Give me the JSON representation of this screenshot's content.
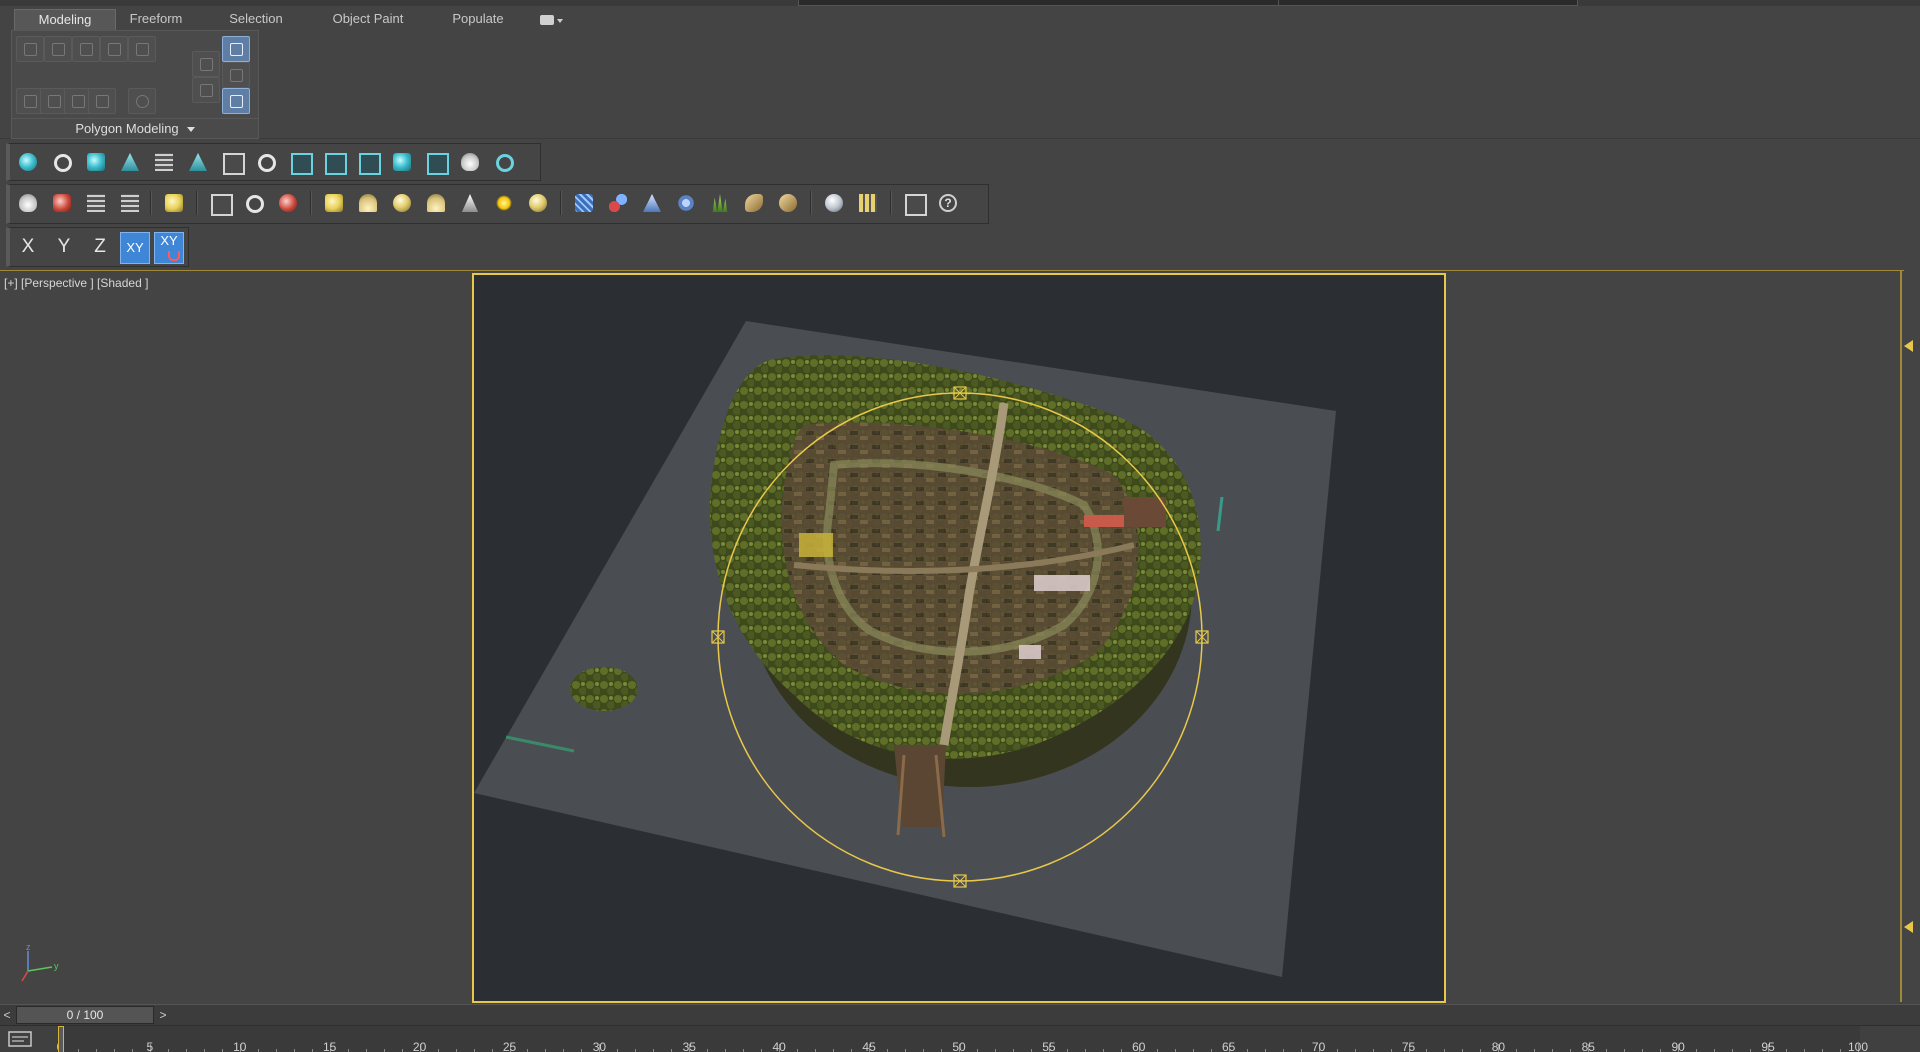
{
  "ribbon": {
    "tabs": [
      {
        "label": "Modeling",
        "active": true
      },
      {
        "label": "Freeform",
        "active": false
      },
      {
        "label": "Selection",
        "active": false
      },
      {
        "label": "Object Paint",
        "active": false
      },
      {
        "label": "Populate",
        "active": false
      }
    ],
    "panel_label": "Polygon Modeling"
  },
  "toolbars": {
    "row1_icons": [
      "light-bulb-icon",
      "sun-light-icon",
      "camera-group-icon",
      "tree-icon",
      "list-icon",
      "prism-icon",
      "tag-icon",
      "ring-icon",
      "render-frame-icon",
      "move-frame-icon",
      "play-frame-icon",
      "camera-icon",
      "frame-icon",
      "teapot-icon",
      "bulb-icon"
    ],
    "row2_icons": [
      "teapot-icon",
      "render-setup-icon",
      "panel-icon",
      "grid-icon",
      "light-lister-icon",
      "camera-icon",
      "material-icon",
      "film-icon",
      "plane-icon",
      "dome-icon",
      "sphere-icon",
      "teapot-primitive-icon",
      "cone-icon",
      "sun-icon",
      "ball-icon",
      "hair-grid-icon",
      "molecule-icon",
      "pyramid-icon",
      "gear-icon",
      "grass-icon",
      "hair-icon",
      "zip-icon",
      "shader-ball-icon",
      "material-grid-icon",
      "clipboard-icon",
      "help-icon"
    ],
    "axes": [
      "X",
      "Y",
      "Z",
      "XY",
      "XY"
    ]
  },
  "viewport": {
    "label": "[+] [Perspective ] [Shaded ]",
    "frame_color": "#e8c84a"
  },
  "timeslider": {
    "value": "0 / 100",
    "prev": "<",
    "next": ">"
  },
  "trackbar": {
    "ticks": [
      0,
      5,
      10,
      15,
      20,
      25,
      30,
      35,
      40,
      45,
      50,
      55,
      60,
      65,
      70,
      75,
      80,
      85,
      90,
      95,
      100
    ]
  },
  "colors": {
    "accent": "#3f86d6",
    "frame": "#e8c84a",
    "background": "#444444"
  }
}
